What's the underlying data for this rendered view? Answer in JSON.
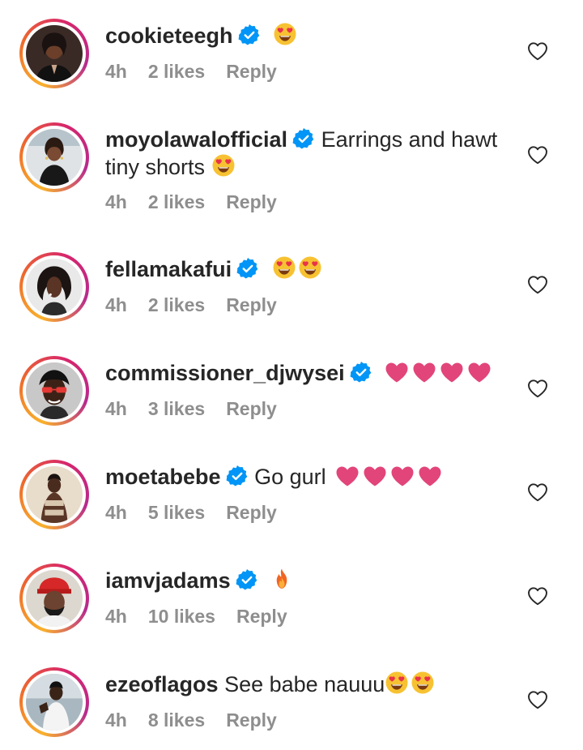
{
  "comments": [
    {
      "username": "cookieteegh",
      "verified": true,
      "text": "",
      "emojis": [
        "heart-eyes-emoji"
      ],
      "time": "4h",
      "likes": "2 likes",
      "reply": "Reply",
      "avatar": "avatar-woman-dark-hair"
    },
    {
      "username": "moyolawalofficial",
      "verified": true,
      "text": "Earrings and hawt",
      "text_line2": "tiny shorts",
      "emojis": [
        "heart-eyes-emoji"
      ],
      "time": "4h",
      "likes": "2 likes",
      "reply": "Reply",
      "avatar": "avatar-woman-black-outfit"
    },
    {
      "username": "fellamakafui",
      "verified": true,
      "text": "",
      "emojis": [
        "heart-eyes-emoji",
        "heart-eyes-emoji"
      ],
      "time": "4h",
      "likes": "2 likes",
      "reply": "Reply",
      "avatar": "avatar-woman-curly-hair"
    },
    {
      "username": "commissioner_djwysei",
      "verified": true,
      "text": "",
      "emojis": [
        "pink-heart-emoji",
        "pink-heart-emoji",
        "pink-heart-emoji",
        "pink-heart-emoji"
      ],
      "time": "4h",
      "likes": "3 likes",
      "reply": "Reply",
      "avatar": "avatar-woman-red-glasses"
    },
    {
      "username": "moetabebe",
      "verified": true,
      "text": "Go gurl",
      "emojis": [
        "pink-heart-emoji",
        "pink-heart-emoji",
        "pink-heart-emoji",
        "pink-heart-emoji"
      ],
      "time": "4h",
      "likes": "5 likes",
      "reply": "Reply",
      "avatar": "avatar-woman-beige"
    },
    {
      "username": "iamvjadams",
      "verified": true,
      "text": "",
      "emojis": [
        "fire-emoji"
      ],
      "time": "4h",
      "likes": "10 likes",
      "reply": "Reply",
      "avatar": "avatar-man-red-cap"
    },
    {
      "username": "ezeoflagos",
      "verified": false,
      "text": "See babe nauuu",
      "emojis": [
        "heart-eyes-emoji",
        "heart-eyes-emoji"
      ],
      "time": "4h",
      "likes": "8 likes",
      "reply": "Reply",
      "avatar": "avatar-man-street"
    }
  ],
  "colors": {
    "verified_blue": "#0095f6",
    "meta_gray": "#8e8e8e",
    "text": "#262626",
    "pink_heart": "#e2457a",
    "emoji_yellow": "#f7c232"
  }
}
